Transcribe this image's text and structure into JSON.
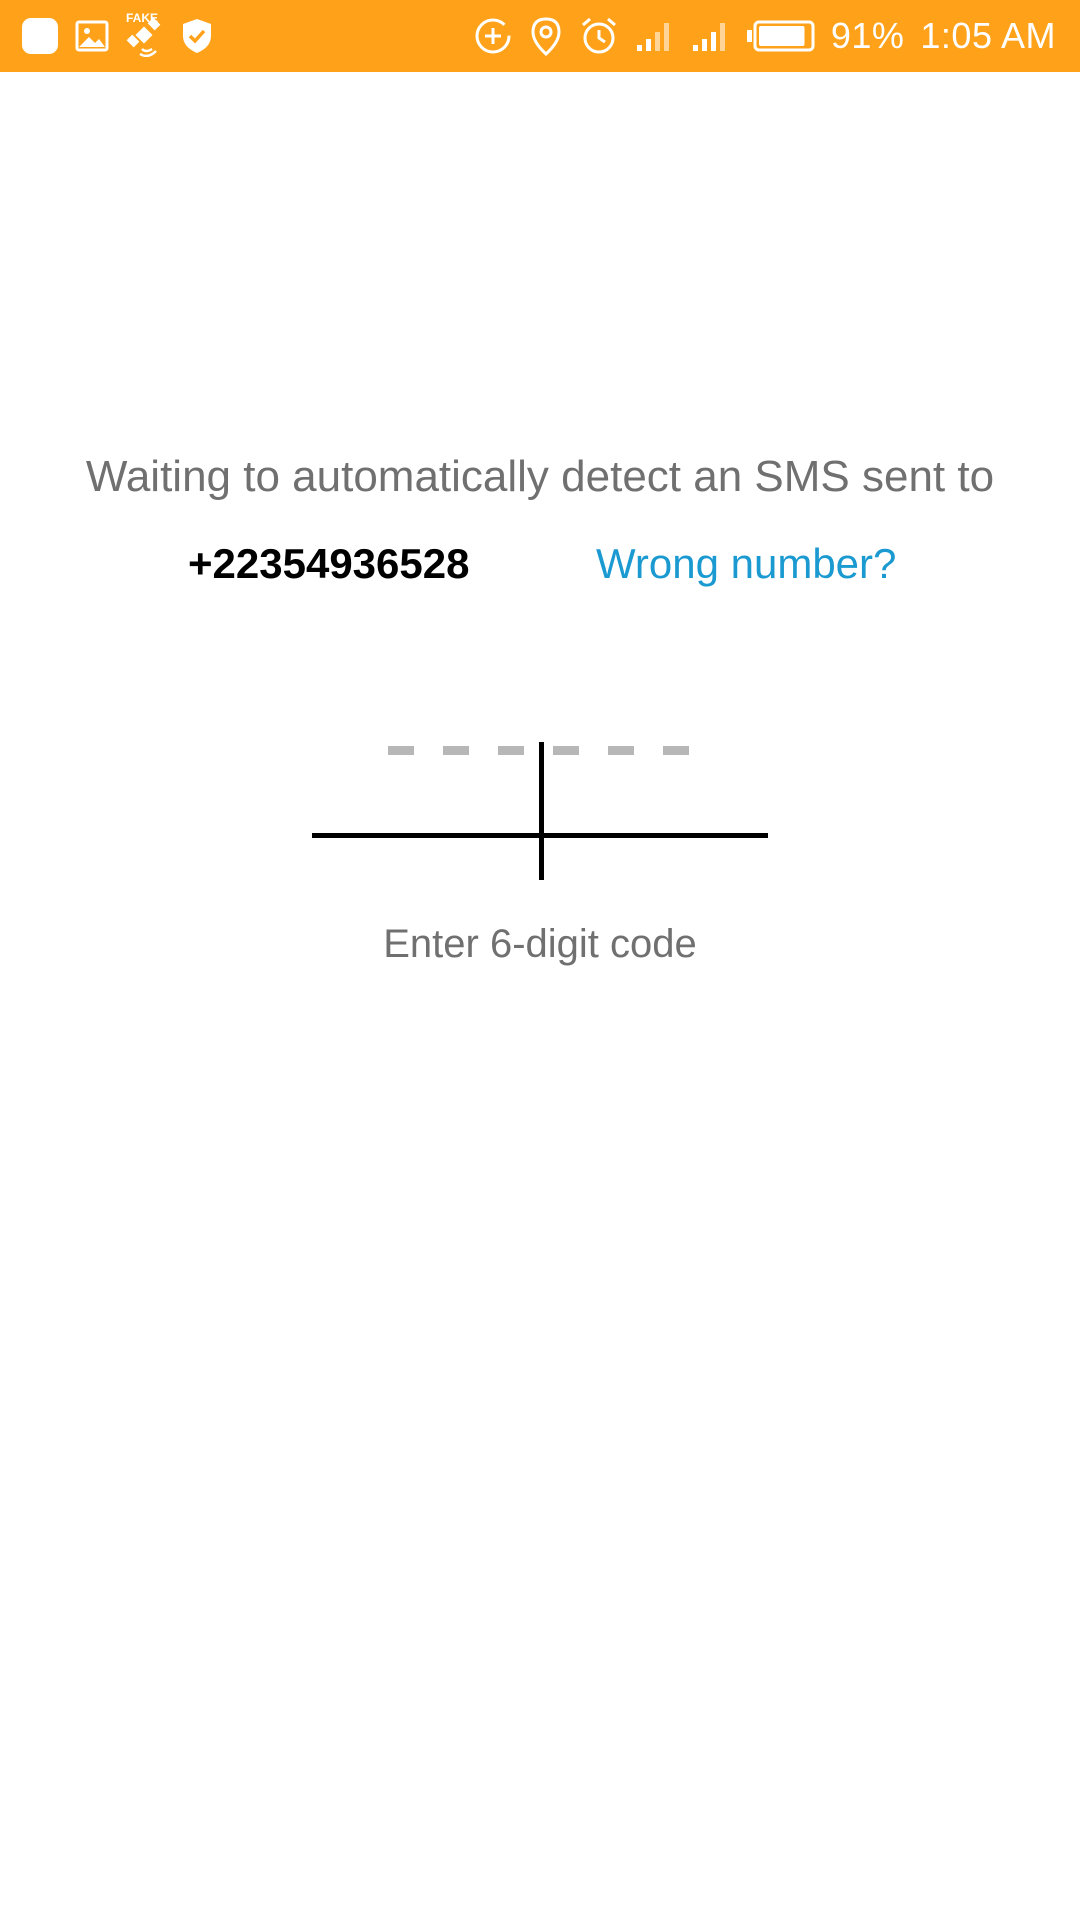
{
  "status_bar": {
    "background_color": "#FFA21A",
    "left_icons": [
      "app-notification-icon",
      "image-icon",
      "fake-gps-icon",
      "shield-check-icon"
    ],
    "fake_gps_label": "FAKE",
    "right_icons": [
      "data-saver-icon",
      "location-icon",
      "alarm-icon",
      "signal-sim1-icon",
      "signal-sim2-icon",
      "battery-icon"
    ],
    "battery_percent": "91%",
    "battery_level": 0.91,
    "time": "1:05 AM"
  },
  "verification": {
    "message": "Waiting to automatically detect an SMS sent to",
    "phone_number": "+22354936528",
    "wrong_number_link": "Wrong number?",
    "code_digits": 6,
    "code_placeholder": "– – – – – –",
    "hint": "Enter 6-digit code",
    "link_color": "#1A9AD0"
  }
}
